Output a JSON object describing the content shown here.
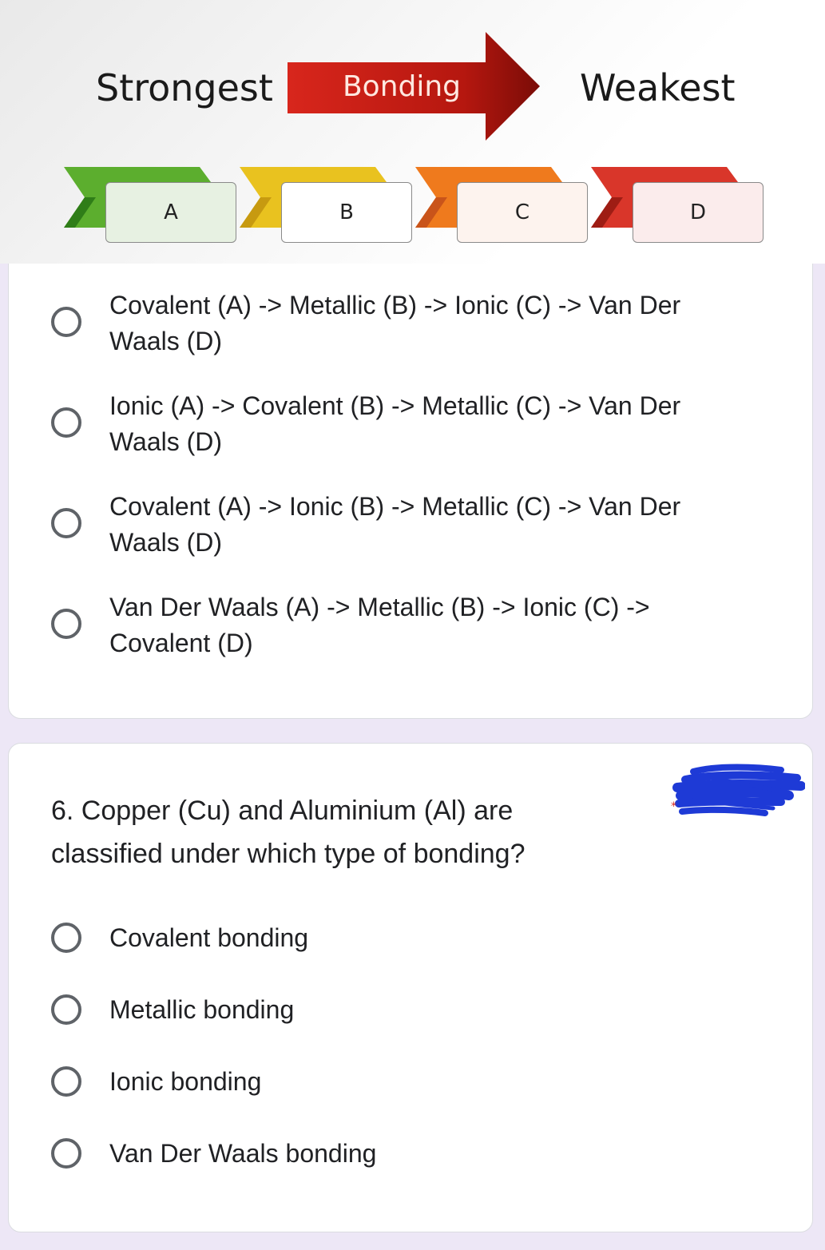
{
  "diagram": {
    "strongest": "Strongest",
    "bonding": "Bonding",
    "weakest": "Weakest",
    "chevrons": [
      {
        "label": "A",
        "color": "#5cae2e",
        "dark": "#2f7d18",
        "box": "#e7f1e2"
      },
      {
        "label": "B",
        "color": "#e9c21f",
        "dark": "#c79a10",
        "box": "#ffffff"
      },
      {
        "label": "C",
        "color": "#ef7a1d",
        "dark": "#c9541a",
        "box": "#fdf3ee"
      },
      {
        "label": "D",
        "color": "#d9362a",
        "dark": "#9e1d14",
        "box": "#fbecec"
      }
    ],
    "arrow_color": "#c9201a"
  },
  "question5": {
    "options": [
      {
        "line1": "Covalent (A) -> Metallic (B) -> Ionic (C) -> Van Der",
        "line2": "Waals (D)"
      },
      {
        "line1": "Ionic (A) -> Covalent (B) -> Metallic (C) -> Van Der",
        "line2": "Waals (D)"
      },
      {
        "line1": "Covalent (A) -> Ionic (B) -> Metallic (C) -> Van Der",
        "line2": "Waals (D)"
      },
      {
        "line1": "Van Der Waals (A) -> Metallic (B) -> Ionic (C) ->",
        "line2": "Covalent (D)"
      }
    ]
  },
  "question6": {
    "title_line1": "6. Copper (Cu) and Aluminium (Al) are",
    "title_line2": "classified under which type of bonding?",
    "options": [
      "Covalent bonding",
      "Metallic bonding",
      "Ionic bonding",
      "Van Der Waals bonding"
    ],
    "redaction_color": "#1e3ad6"
  }
}
